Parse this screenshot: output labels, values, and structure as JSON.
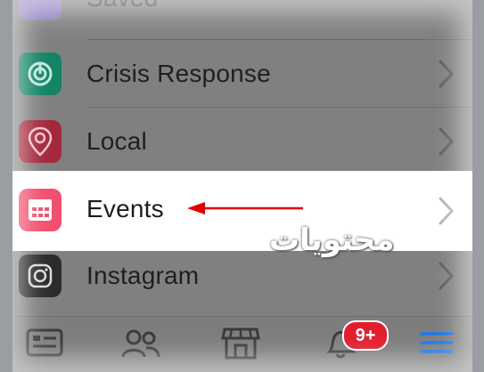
{
  "menu": {
    "partial_top_label": "Saved",
    "items": [
      {
        "label": "Crisis Response",
        "icon": "crisis-response-icon",
        "color": "#1ca37c"
      },
      {
        "label": "Local",
        "icon": "location-pin-icon",
        "color": "#e6415a"
      },
      {
        "label": "Events",
        "icon": "calendar-icon",
        "color": "#f0506e"
      },
      {
        "label": "Instagram",
        "icon": "instagram-icon",
        "color": "#3a3a3a"
      }
    ]
  },
  "annotation": {
    "arrow_color": "#e00000"
  },
  "tabbar": {
    "tabs": [
      {
        "icon": "news-feed-icon"
      },
      {
        "icon": "friends-icon"
      },
      {
        "icon": "marketplace-icon"
      },
      {
        "icon": "notifications-bell-icon"
      },
      {
        "icon": "menu-icon",
        "color": "#1877f2"
      }
    ],
    "notifications_badge": "9+"
  },
  "watermark": {
    "text": "محتويات"
  }
}
